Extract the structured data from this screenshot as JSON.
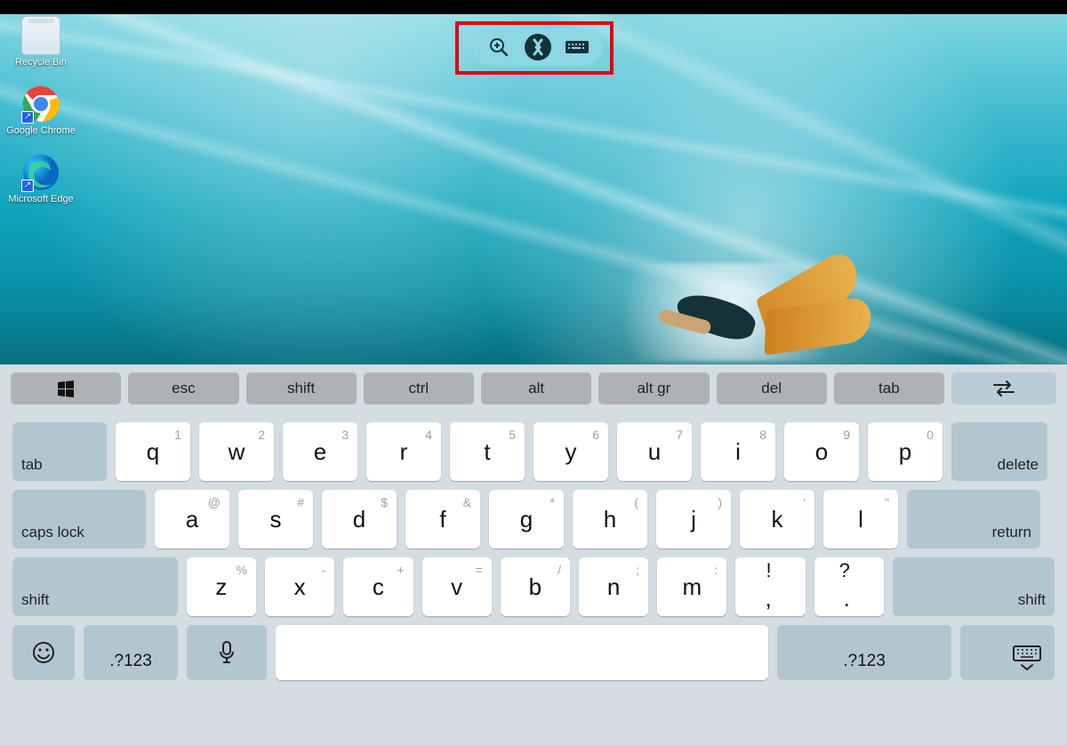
{
  "desktop_icons": [
    {
      "label": "Recycle Bin"
    },
    {
      "label": "Google Chrome"
    },
    {
      "label": "Microsoft Edge"
    }
  ],
  "toolbar": {
    "zoom": "zoom-in",
    "remote": "remote-desktop",
    "keyboard": "on-screen-keyboard"
  },
  "fnrow": [
    "",
    "esc",
    "shift",
    "ctrl",
    "alt",
    "alt gr",
    "del",
    "tab",
    ""
  ],
  "rows": {
    "r1": {
      "modL": "tab",
      "modR": "delete",
      "keys": [
        {
          "p": "q",
          "s": "1"
        },
        {
          "p": "w",
          "s": "2"
        },
        {
          "p": "e",
          "s": "3"
        },
        {
          "p": "r",
          "s": "4"
        },
        {
          "p": "t",
          "s": "5"
        },
        {
          "p": "y",
          "s": "6"
        },
        {
          "p": "u",
          "s": "7"
        },
        {
          "p": "i",
          "s": "8"
        },
        {
          "p": "o",
          "s": "9"
        },
        {
          "p": "p",
          "s": "0"
        }
      ]
    },
    "r2": {
      "modL": "caps lock",
      "modR": "return",
      "keys": [
        {
          "p": "a",
          "s": "@"
        },
        {
          "p": "s",
          "s": "#"
        },
        {
          "p": "d",
          "s": "$"
        },
        {
          "p": "f",
          "s": "&"
        },
        {
          "p": "g",
          "s": "*"
        },
        {
          "p": "h",
          "s": "("
        },
        {
          "p": "j",
          "s": ")"
        },
        {
          "p": "k",
          "s": "'"
        },
        {
          "p": "l",
          "s": "\""
        }
      ]
    },
    "r3": {
      "modL": "shift",
      "modR": "shift",
      "keys": [
        {
          "p": "z",
          "s": "%"
        },
        {
          "p": "x",
          "s": "-"
        },
        {
          "p": "c",
          "s": "+"
        },
        {
          "p": "v",
          "s": "="
        },
        {
          "p": "b",
          "s": "/"
        },
        {
          "p": "n",
          "s": ";"
        },
        {
          "p": "m",
          "s": ":"
        }
      ],
      "punct": [
        {
          "p": ",",
          "s": "!"
        },
        {
          "p": ".",
          "s": "?"
        }
      ]
    },
    "r4": {
      "num": ".?123"
    }
  }
}
